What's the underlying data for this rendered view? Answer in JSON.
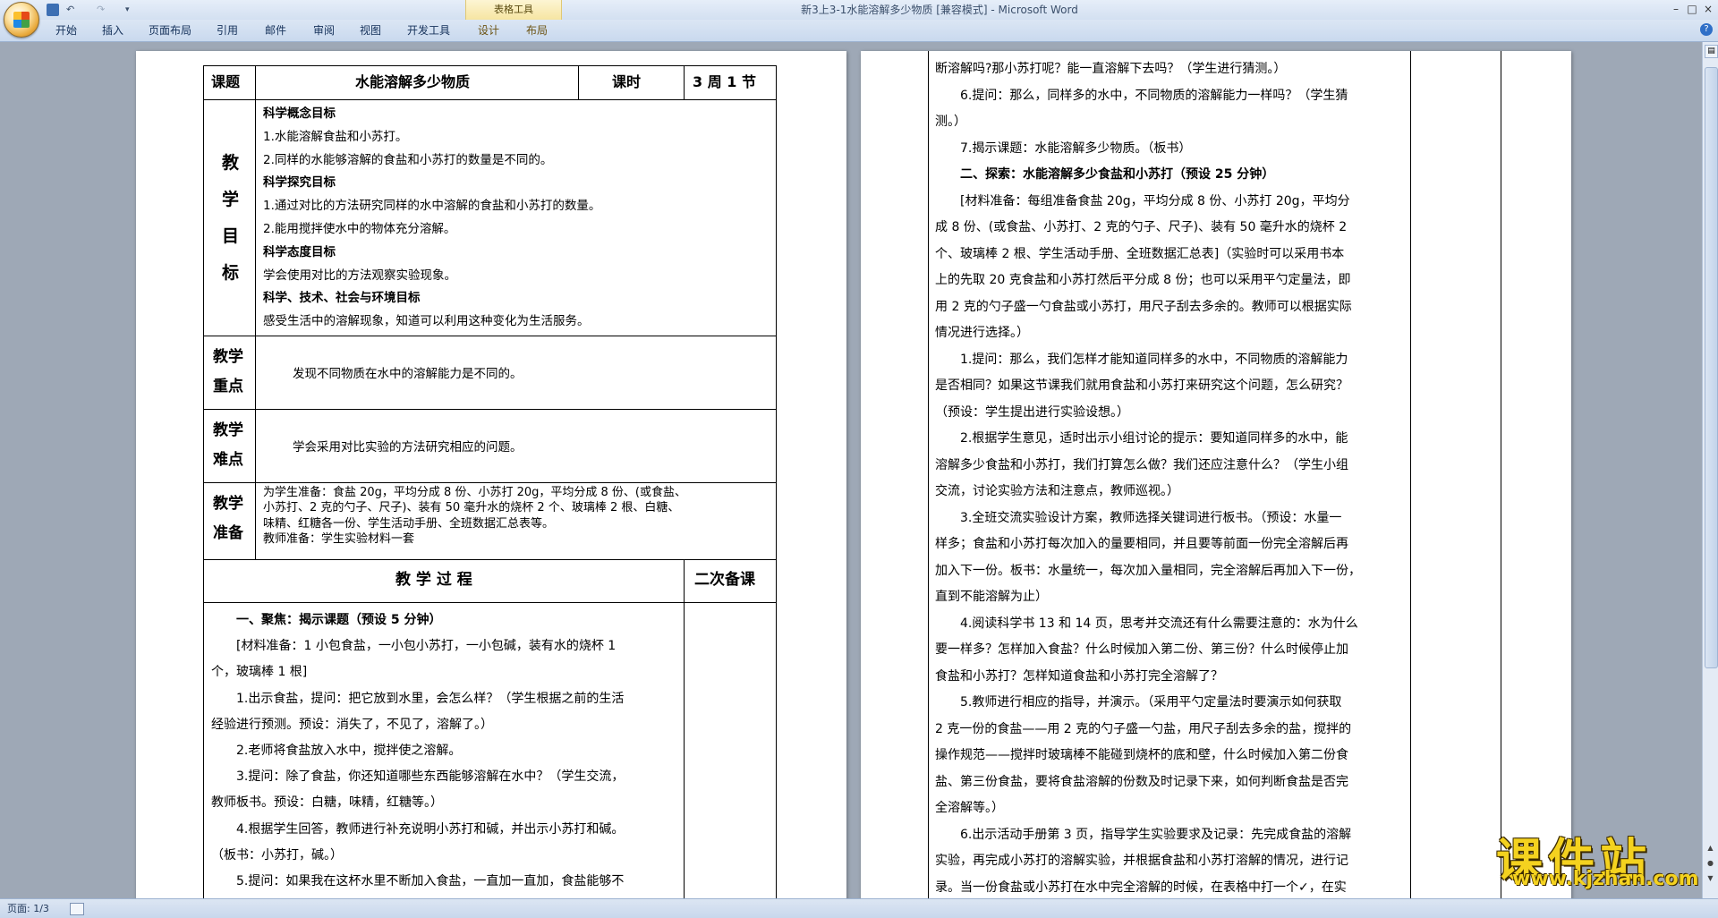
{
  "window": {
    "title": "新3上3-1水能溶解多少物质 [兼容模式] - Microsoft Word",
    "context_tab_group": "表格工具",
    "quick_access": {
      "undo": "↶",
      "redo": "↷",
      "more": "▾"
    },
    "controls": {
      "min": "–",
      "max": "□",
      "close": "×"
    }
  },
  "ribbon": {
    "tabs": [
      "开始",
      "插入",
      "页面布局",
      "引用",
      "邮件",
      "审阅",
      "视图",
      "开发工具",
      "设计",
      "布局"
    ],
    "help": "?"
  },
  "doc": {
    "page1": {
      "header": {
        "label1": "课题",
        "topic": "水能溶解多少物质",
        "label2": "课时",
        "period": "3 周 1 节"
      },
      "objectives": {
        "label": [
          "教",
          "学",
          "目",
          "标"
        ],
        "lines": [
          {
            "text": "科学概念目标",
            "bold": true
          },
          {
            "text": "1.水能溶解食盐和小苏打。"
          },
          {
            "text": "2.同样的水能够溶解的食盐和小苏打的数量是不同的。"
          },
          {
            "text": "科学探究目标",
            "bold": true
          },
          {
            "text": "1.通过对比的方法研究同样的水中溶解的食盐和小苏打的数量。"
          },
          {
            "text": "2.能用搅拌使水中的物体充分溶解。"
          },
          {
            "text": "科学态度目标",
            "bold": true
          },
          {
            "text": "学会使用对比的方法观察实验现象。"
          },
          {
            "text": "科学、技术、社会与环境目标",
            "bold": true
          },
          {
            "text": "感受生活中的溶解现象，知道可以利用这种变化为生活服务。"
          }
        ]
      },
      "key_point": {
        "label1": "教学",
        "label2": "重点",
        "text": "发现不同物质在水中的溶解能力是不同的。"
      },
      "difficulty": {
        "label1": "教学",
        "label2": "难点",
        "text": "学会采用对比实验的方法研究相应的问题。"
      },
      "preparation": {
        "label1": "教学",
        "label2": "准备",
        "lines": [
          "为学生准备：食盐 20g，平均分成 8 份、小苏打 20g，平均分成 8 份、(或食盐、",
          "小苏打、2 克的勺子、尺子)、装有 50 毫升水的烧杯 2 个、玻璃棒 2 根、白糖、",
          "味精、红糖各一份、学生活动手册、全班数据汇总表等。",
          "教师准备：学生实验材料一套"
        ]
      },
      "process": {
        "header": "教 学 过 程",
        "second_prep": "二次备课",
        "lines": [
          {
            "text": "　　一、聚焦：揭示课题（预设 5 分钟）",
            "bold": true
          },
          {
            "text": "　　[材料准备：1 小包食盐，一小包小苏打，一小包碱，装有水的烧杯 1"
          },
          {
            "text": "个，玻璃棒 1 根]"
          },
          {
            "text": "　　1.出示食盐，提问：把它放到水里，会怎么样？（学生根据之前的生活"
          },
          {
            "text": "经验进行预测。预设：消失了，不见了，溶解了。）"
          },
          {
            "text": "　　2.老师将食盐放入水中，搅拌使之溶解。"
          },
          {
            "text": "　　3.提问：除了食盐，你还知道哪些东西能够溶解在水中？（学生交流，"
          },
          {
            "text": "教师板书。预设：白糖，味精，红糖等。）"
          },
          {
            "text": "　　4.根据学生回答，教师进行补充说明小苏打和碱，并出示小苏打和碱。"
          },
          {
            "text": "（板书：小苏打，碱。）"
          },
          {
            "text": "　　5.提问：如果我在这杯水里不断加入食盐，一直加一直加，食盐能够不"
          }
        ]
      }
    },
    "page2": {
      "lines": [
        {
          "text": "断溶解吗?那小苏打呢？能一直溶解下去吗？（学生进行猜测。）"
        },
        {
          "text": "　　6.提问：那么，同样多的水中，不同物质的溶解能力一样吗？（学生猜"
        },
        {
          "text": "测。）"
        },
        {
          "text": "　　7.揭示课题：水能溶解多少物质。（板书）"
        },
        {
          "text": "　　二、探索：水能溶解多少食盐和小苏打（预设 25 分钟）",
          "bold": true
        },
        {
          "text": "　　[材料准备：每组准备食盐 20g，平均分成 8 份、小苏打 20g，平均分"
        },
        {
          "text": "成 8 份、(或食盐、小苏打、2 克的勺子、尺子)、装有 50 毫升水的烧杯 2"
        },
        {
          "text": "个、玻璃棒 2 根、学生活动手册、全班数据汇总表]（实验时可以采用书本"
        },
        {
          "text": "上的先取 20 克食盐和小苏打然后平分成 8 份；也可以采用平勺定量法，即"
        },
        {
          "text": "用 2 克的勺子盛一勺食盐或小苏打，用尺子刮去多余的。教师可以根据实际"
        },
        {
          "text": "情况进行选择。）"
        },
        {
          "text": "　　1.提问：那么，我们怎样才能知道同样多的水中，不同物质的溶解能力"
        },
        {
          "text": "是否相同？如果这节课我们就用食盐和小苏打来研究这个问题，怎么研究？"
        },
        {
          "text": "（预设：学生提出进行实验设想。）"
        },
        {
          "text": "　　2.根据学生意见，适时出示小组讨论的提示：要知道同样多的水中，能"
        },
        {
          "text": "溶解多少食盐和小苏打，我们打算怎么做？我们还应注意什么？（学生小组"
        },
        {
          "text": "交流，讨论实验方法和注意点，教师巡视。）"
        },
        {
          "text": "　　3.全班交流实验设计方案，教师选择关键词进行板书。（预设：水量一"
        },
        {
          "text": "样多；食盐和小苏打每次加入的量要相同，并且要等前面一份完全溶解后再"
        },
        {
          "text": "加入下一份。板书：水量统一，每次加入量相同，完全溶解后再加入下一份，"
        },
        {
          "text": "直到不能溶解为止）"
        },
        {
          "text": "　　4.阅读科学书 13 和 14 页，思考并交流还有什么需要注意的：水为什么"
        },
        {
          "text": "要一样多？怎样加入食盐？什么时候加入第二份、第三份？什么时候停止加"
        },
        {
          "text": "食盐和小苏打？怎样知道食盐和小苏打完全溶解了？"
        },
        {
          "text": "　　5.教师进行相应的指导，并演示。（采用平勺定量法时要演示如何获取"
        },
        {
          "text": "2 克一份的食盐——用 2 克的勺子盛一勺盐，用尺子刮去多余的盐，搅拌的"
        },
        {
          "text": "操作规范——搅拌时玻璃棒不能碰到烧杯的底和壁，什么时候加入第二份食"
        },
        {
          "text": "盐、第三份食盐，要将食盐溶解的份数及时记录下来，如何判断食盐是否完"
        },
        {
          "text": "全溶解等。）"
        },
        {
          "text": "　　6.出示活动手册第 3 页，指导学生实验要求及记录：先完成食盐的溶解"
        },
        {
          "text": "实验，再完成小苏打的溶解实验，并根据食盐和小苏打溶解的情况，进行记"
        },
        {
          "text": "录。当一份食盐或小苏打在水中完全溶解的时候，在表格中打一个✓，在实"
        }
      ]
    }
  },
  "status": {
    "page": "页面: 1/3"
  },
  "watermark": {
    "cn": "课件站",
    "url": "www.kjzhan.com"
  }
}
